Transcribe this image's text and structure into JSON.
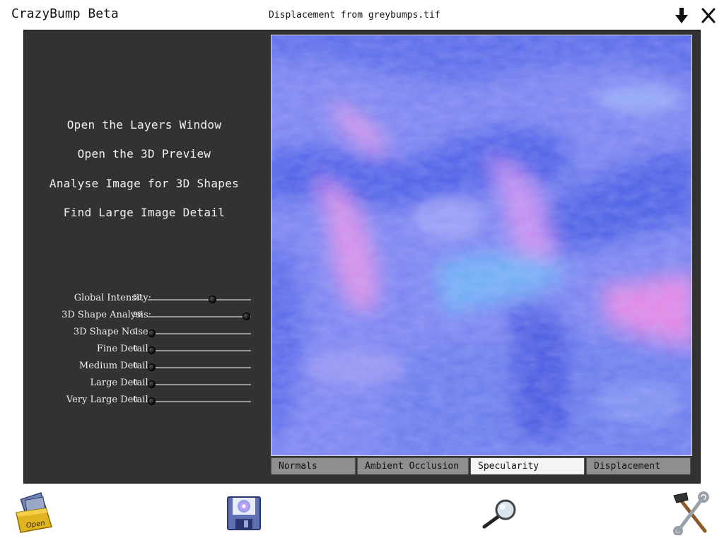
{
  "window": {
    "app_title": "CrazyBump Beta",
    "document_title": "Displacement from greybumps.tif"
  },
  "actions": [
    {
      "label": "Open the Layers Window"
    },
    {
      "label": "Open the 3D Preview"
    },
    {
      "label": "Analyse Image for 3D Shapes"
    },
    {
      "label": "Find Large Image Detail"
    }
  ],
  "sliders": [
    {
      "label": "Global Intensity:",
      "value": "50",
      "level": 0.64
    },
    {
      "label": "3D Shape Analysis:",
      "value": "99",
      "level": 0.99
    },
    {
      "label": "3D Shape Noise:",
      "value": "0",
      "level": 0.0
    },
    {
      "label": "Fine Detail:",
      "value": "0",
      "level": 0.0
    },
    {
      "label": "Medium Detail:",
      "value": "0",
      "level": 0.0
    },
    {
      "label": "Large Detail:",
      "value": "0",
      "level": 0.0
    },
    {
      "label": "Very Large Detail:",
      "value": "0",
      "level": 0.0
    }
  ],
  "tabs": [
    {
      "label": "Normals",
      "active": false
    },
    {
      "label": "Ambient Occlusion",
      "active": false
    },
    {
      "label": "Specularity",
      "active": true
    },
    {
      "label": "Displacement",
      "active": false
    }
  ],
  "bottom_toolbar": {
    "open_label": "Open",
    "open_icon": "open-folder-icon",
    "save_icon": "floppy-disk-icon",
    "zoom_icon": "magnifier-icon",
    "settings_icon": "hammer-wrench-icon"
  },
  "colors": {
    "panel_bg": "#323232",
    "normal_map_base": "#7b84f0",
    "tab_inactive": "#8f8f8f",
    "tab_active": "#f4f4f4"
  }
}
